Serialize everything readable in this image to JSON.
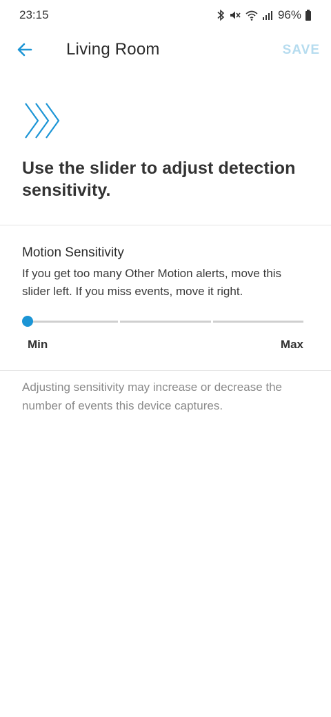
{
  "status_bar": {
    "time": "23:15",
    "icons": [
      "bluetooth-icon",
      "mute-icon",
      "wifi-icon",
      "signal-icon",
      "battery-icon"
    ],
    "battery_percent": "96%"
  },
  "header": {
    "back_icon": "arrow-left-icon",
    "title": "Living Room",
    "save_label": "SAVE"
  },
  "hero": {
    "icon": "triple-chevron-right-icon",
    "headline": "Use the slider to adjust detection sensitivity."
  },
  "motion_sensitivity": {
    "title": "Motion Sensitivity",
    "description": "If you get too many Other Motion alerts, move this slider left. If you miss events, move it right.",
    "slider": {
      "min_label": "Min",
      "max_label": "Max",
      "steps": 3,
      "value_fraction": 0
    }
  },
  "footnote": "Adjusting sensitivity may increase or decrease the number of events this device captures.",
  "colors": {
    "accent": "#1c95d5",
    "save_disabled": "#b6dcef",
    "track": "#cfcfcf",
    "muted_text": "#8a8a8a"
  }
}
